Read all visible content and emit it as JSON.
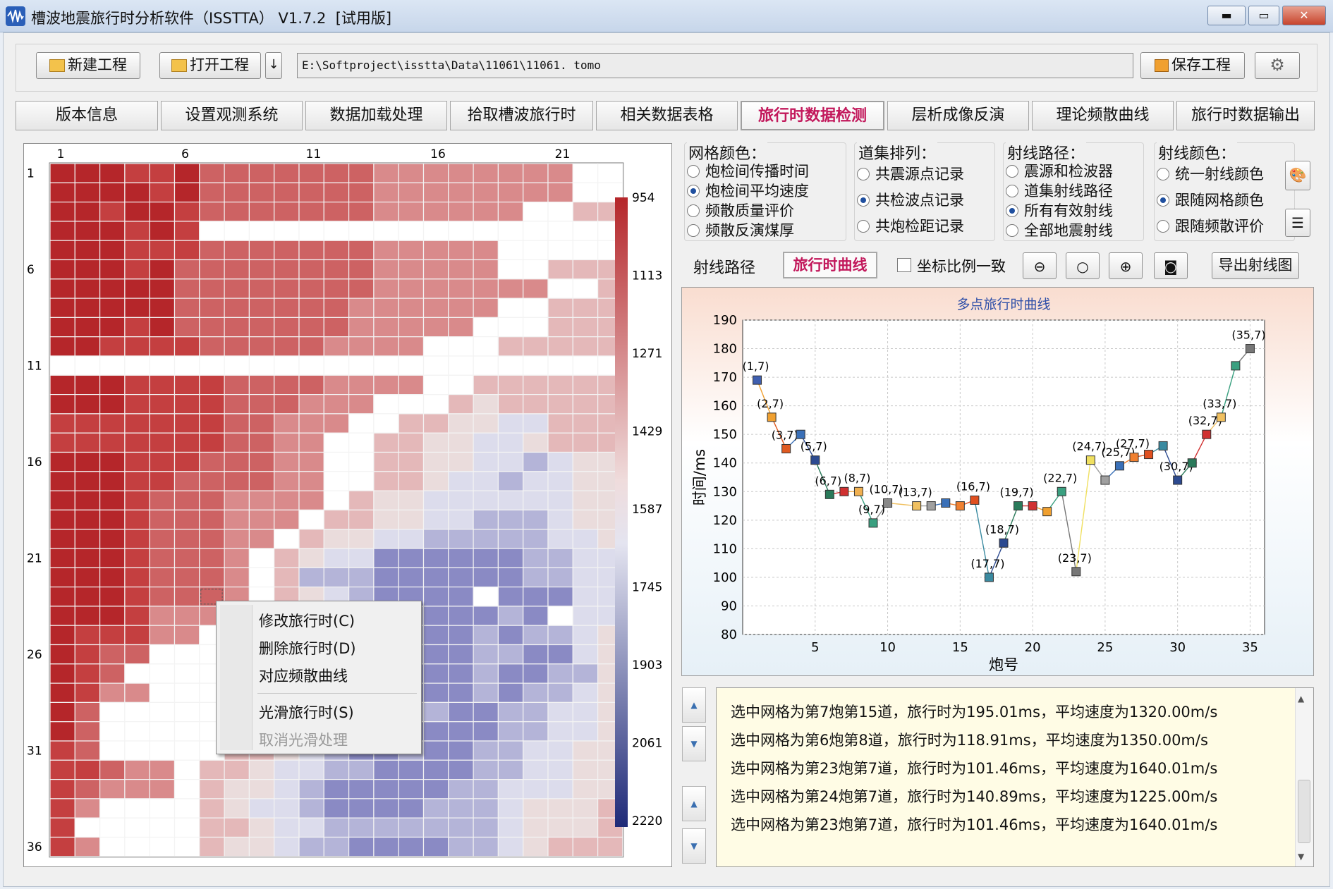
{
  "window": {
    "title": "槽波地震旅行时分析软件（ISSTTA） V1.7.2  [试用版]",
    "min": "▬",
    "max": "▭",
    "close": "✕"
  },
  "toolbar": {
    "new": "新建工程",
    "open": "打开工程",
    "arrow": "↓",
    "path": "E:\\Softproject\\isstta\\Data\\11061\\11061. tomo",
    "save": "保存工程"
  },
  "tabs": [
    "版本信息",
    "设置观测系统",
    "数据加载处理",
    "拾取槽波旅行时",
    "相关数据表格",
    "旅行时数据检测",
    "层析成像反演",
    "理论频散曲线",
    "旅行时数据输出"
  ],
  "active_tab": 5,
  "grid": {
    "col_labels": [
      "1",
      "6",
      "11",
      "16",
      "21"
    ],
    "row_labels": [
      "1",
      "6",
      "11",
      "16",
      "21",
      "26",
      "31",
      "36"
    ],
    "colorbar": [
      "954",
      "1113",
      "1271",
      "1429",
      "1587",
      "1745",
      "1903",
      "2061",
      "2220"
    ],
    "rows": [
      "00011022222223333333344",
      "00001022222223333333344",
      "00100122222223333334455",
      "00010144444444444444444",
      "00011122222223333344444",
      "00010222222223333344555",
      "00000222222223333333445",
      "00000222222233333344555",
      "00010222222233333444555",
      "00111122222333344455555",
      "44444444444444444444444",
      "00011112222333344555555",
      "00011112223334445655555",
      "11111112233344556677555",
      "11111112233445566776555",
      "00011122233445566778766",
      "00011222233445567787766",
      "00012223333456677777766",
      "00012223334556677888766",
      "00012223345667788888776",
      "00012223456779999998877",
      "00012223458889999998877",
      "00012223456789999499977",
      "00013333445567899989477",
      "01113344445567899898876",
      "01224444456778899889976",
      "01244444556789999899886",
      "01334444456788999898876",
      "02444444567899889988776",
      "02444444567899999988776",
      "12444445567899899887766",
      "11233455677889999887766",
      "12333456678999998877766",
      "13444456778999988876665",
      "14444455677888888876665",
      "13444456678899998876555"
    ]
  },
  "context_menu": [
    "修改旅行时(C)",
    "删除旅行时(D)",
    "对应频散曲线",
    "光滑旅行时(S)",
    "取消光滑处理"
  ],
  "groups": {
    "mesh_color": {
      "title": "网格颜色：",
      "options": [
        "炮检间传播时间",
        "炮检间平均速度",
        "频散质量评价",
        "频散反演煤厚"
      ],
      "selected": 1
    },
    "gather": {
      "title": "道集排列：",
      "options": [
        "共震源点记录",
        "共检波点记录",
        "共炮检距记录"
      ],
      "selected": 1
    },
    "ray_path": {
      "title": "射线路径：",
      "options": [
        "震源和检波器",
        "道集射线路径",
        "所有有效射线",
        "全部地震射线"
      ],
      "selected": 2
    },
    "ray_color": {
      "title": "射线颜色：",
      "options": [
        "统一射线颜色",
        "跟随网格颜色",
        "跟随频散评价"
      ],
      "selected": 1
    }
  },
  "subtabs": {
    "ray": "射线路径",
    "curve": "旅行时曲线",
    "keep_ratio": "坐标比例一致",
    "export": "导出射线图"
  },
  "chart_data": {
    "type": "line",
    "title": "多点旅行时曲线",
    "xlabel": "炮号",
    "ylabel": "时间/ms",
    "xlim": [
      0,
      36
    ],
    "ylim": [
      80,
      190
    ],
    "xticks": [
      5,
      10,
      15,
      20,
      25,
      30,
      35
    ],
    "yticks": [
      80,
      90,
      100,
      110,
      120,
      130,
      140,
      150,
      160,
      170,
      180,
      190
    ],
    "points": [
      {
        "x": 1,
        "y": 169,
        "label": "(1,7)",
        "c": "#3f5fb0"
      },
      {
        "x": 2,
        "y": 156,
        "label": "(2,7)",
        "c": "#f0a030"
      },
      {
        "x": 3,
        "y": 145,
        "label": "(3,7)",
        "c": "#e05a20"
      },
      {
        "x": 4,
        "y": 150,
        "label": "",
        "c": "#3a70b8"
      },
      {
        "x": 5,
        "y": 141,
        "label": "(5,7)",
        "c": "#2c4a90"
      },
      {
        "x": 6,
        "y": 129,
        "label": "(6,7)",
        "c": "#2a7a5a"
      },
      {
        "x": 7,
        "y": 130,
        "label": "",
        "c": "#d03030"
      },
      {
        "x": 8,
        "y": 130,
        "label": "(8,7)",
        "c": "#f0b050"
      },
      {
        "x": 9,
        "y": 119,
        "label": "(9,7)",
        "c": "#3aa080"
      },
      {
        "x": 10,
        "y": 126,
        "label": "(10,7)",
        "c": "#888888"
      },
      {
        "x": 12,
        "y": 125,
        "label": "(13,7)",
        "c": "#f0c060"
      },
      {
        "x": 13,
        "y": 125,
        "label": "",
        "c": "#a0a0a0"
      },
      {
        "x": 14,
        "y": 126,
        "label": "",
        "c": "#3a70b8"
      },
      {
        "x": 15,
        "y": 125,
        "label": "",
        "c": "#f08030"
      },
      {
        "x": 16,
        "y": 127,
        "label": "(16,7)",
        "c": "#e05020"
      },
      {
        "x": 17,
        "y": 100,
        "label": "(17,7)",
        "c": "#3a8aa0"
      },
      {
        "x": 18,
        "y": 112,
        "label": "(18,7)",
        "c": "#2c4a90"
      },
      {
        "x": 19,
        "y": 125,
        "label": "(19,7)",
        "c": "#2a7a5a"
      },
      {
        "x": 20,
        "y": 125,
        "label": "",
        "c": "#d03030"
      },
      {
        "x": 21,
        "y": 123,
        "label": "",
        "c": "#f0a030"
      },
      {
        "x": 22,
        "y": 130,
        "label": "(22,7)",
        "c": "#3aa080"
      },
      {
        "x": 23,
        "y": 102,
        "label": "(23,7)",
        "c": "#777777"
      },
      {
        "x": 24,
        "y": 141,
        "label": "(24,7)",
        "c": "#f0e060"
      },
      {
        "x": 25,
        "y": 134,
        "label": "",
        "c": "#a0a0a0"
      },
      {
        "x": 26,
        "y": 139,
        "label": "(25,7)",
        "c": "#3a70b8"
      },
      {
        "x": 27,
        "y": 142,
        "label": "(27,7)",
        "c": "#f08030"
      },
      {
        "x": 28,
        "y": 143,
        "label": "",
        "c": "#e05020"
      },
      {
        "x": 29,
        "y": 146,
        "label": "",
        "c": "#3a8aa0"
      },
      {
        "x": 30,
        "y": 134,
        "label": "(30,7)",
        "c": "#2c4a90"
      },
      {
        "x": 31,
        "y": 140,
        "label": "",
        "c": "#2a7a5a"
      },
      {
        "x": 32,
        "y": 150,
        "label": "(32,7)",
        "c": "#d03030"
      },
      {
        "x": 33,
        "y": 156,
        "label": "(33,7)",
        "c": "#f0c060"
      },
      {
        "x": 34,
        "y": 174,
        "label": "",
        "c": "#3aa080"
      },
      {
        "x": 35,
        "y": 180,
        "label": "(35,7)",
        "c": "#777777"
      }
    ]
  },
  "log": [
    "选中网格为第7炮第15道，旅行时为195.01ms，平均速度为1320.00m/s",
    "选中网格为第6炮第8道，旅行时为118.91ms，平均速度为1350.00m/s",
    "选中网格为第23炮第7道，旅行时为101.46ms，平均速度为1640.01m/s",
    "选中网格为第24炮第7道，旅行时为140.89ms，平均速度为1225.00m/s",
    "选中网格为第23炮第7道，旅行时为101.46ms，平均速度为1640.01m/s"
  ],
  "palette": [
    "#b5262a",
    "#c43f40",
    "#cd6263",
    "#d98a8b",
    "#ffffff",
    "#e4b8b9",
    "#eadcdc",
    "#dcdcec",
    "#b4b4d8",
    "#8a8ac4",
    "#5252a8",
    "#2b2b88"
  ],
  "arrows": {
    "up": "▲",
    "down": "▼"
  }
}
